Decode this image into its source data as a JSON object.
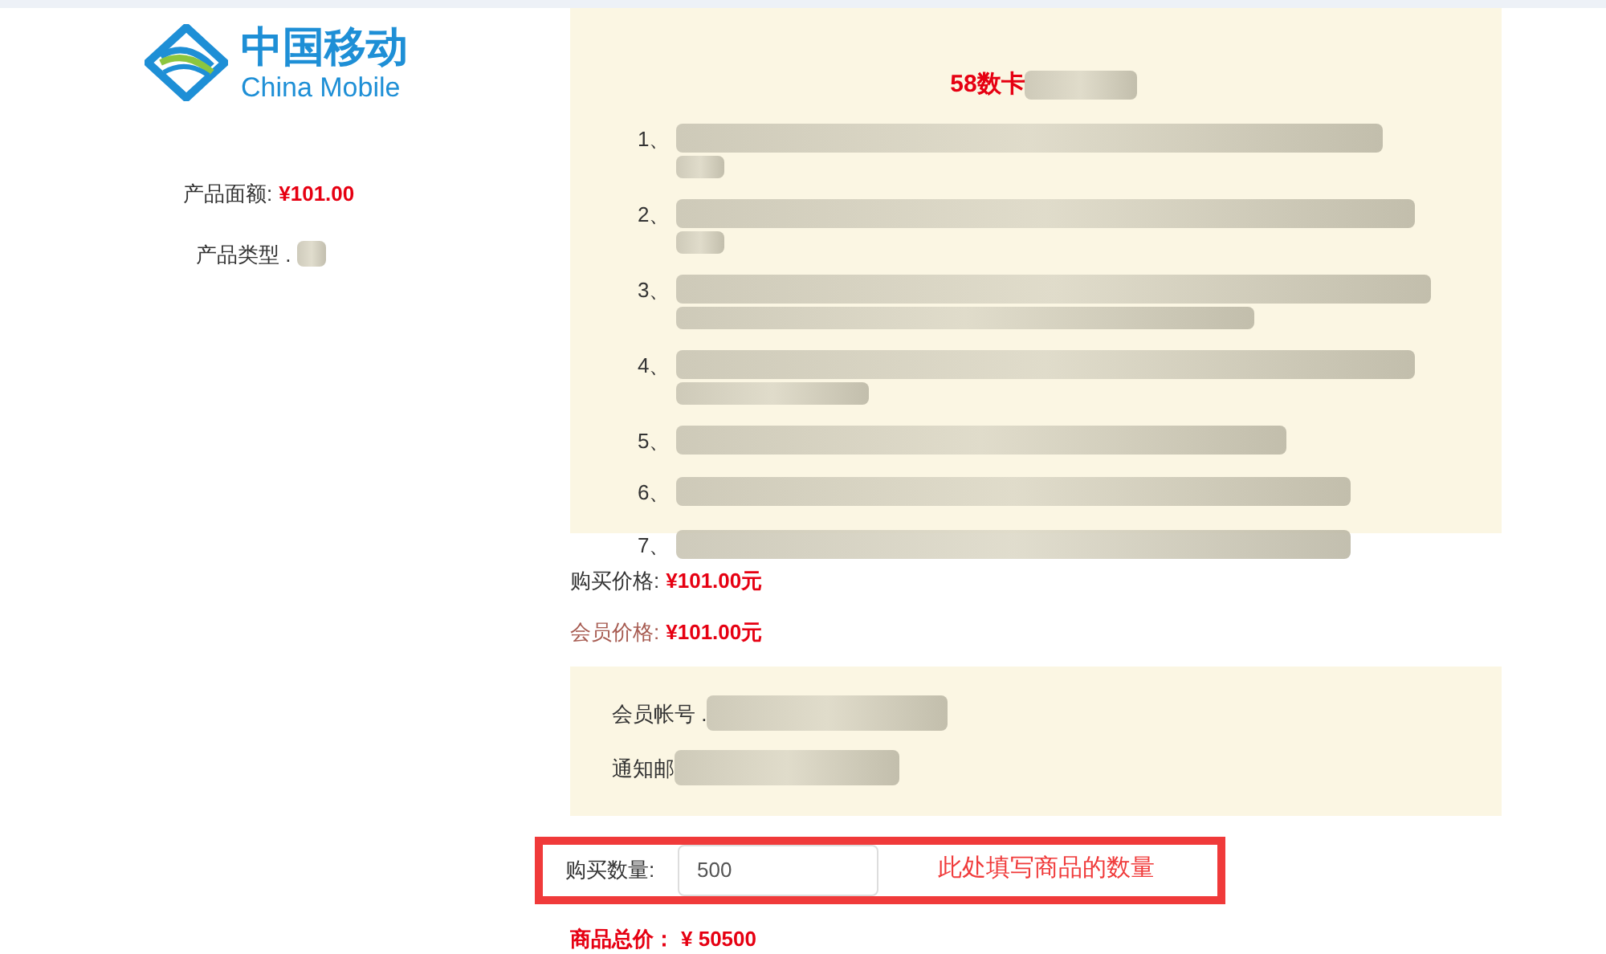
{
  "brand": {
    "name_cn": "中国移动",
    "name_en": "China Mobile"
  },
  "product": [
    {
      "label": "产品面额:",
      "value": "¥101.00"
    },
    {
      "label": "产品类型 ."
    }
  ],
  "description": {
    "title": "58数卡",
    "items": [
      {
        "number": "1、"
      },
      {
        "number": "2、"
      },
      {
        "number": "3、"
      },
      {
        "number": "4、"
      },
      {
        "number": "5、"
      },
      {
        "number": "6、"
      },
      {
        "number": "7、"
      }
    ]
  },
  "prices": [
    {
      "label": "购买价格:",
      "value": "¥101.00元",
      "kind": "normal"
    },
    {
      "label": "会员价格:",
      "value": "¥101.00元",
      "kind": "member"
    }
  ],
  "account": [
    {
      "label": "会员帐号 ."
    },
    {
      "label": "通知邮"
    }
  ],
  "quantity": {
    "label": "购买数量:",
    "value": "500",
    "note": "此处填写商品的数量"
  },
  "total": {
    "label": "商品总价：",
    "value": "¥ 50500"
  }
}
